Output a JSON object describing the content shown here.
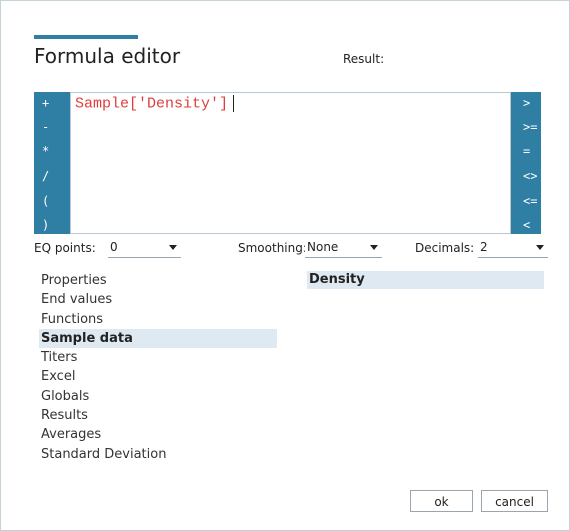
{
  "dialog": {
    "title": "Formula editor",
    "result_label": "Result:"
  },
  "operators": {
    "left": [
      "+",
      "-",
      "*",
      "/",
      "(",
      ")"
    ],
    "right": [
      ">",
      ">=",
      "=",
      "<>",
      "<=",
      "<"
    ]
  },
  "formula": {
    "text": "Sample['Density']"
  },
  "controls": {
    "eq_points": {
      "label": "EQ points:",
      "value": "0"
    },
    "smoothing": {
      "label": "Smoothing:",
      "value": "None"
    },
    "decimals": {
      "label": "Decimals:",
      "value": "2"
    }
  },
  "categories": {
    "items": [
      "Properties",
      "End values",
      "Functions",
      "Sample data",
      "Titers",
      "Excel",
      "Globals",
      "Results",
      "Averages",
      "Standard Deviation"
    ],
    "selected": "Sample data"
  },
  "values": {
    "items": [
      "Density"
    ]
  },
  "buttons": {
    "ok": "ok",
    "cancel": "cancel"
  },
  "colors": {
    "accent": "#2f7ea3",
    "selection": "#dfe9f1",
    "formula_text": "#e03c3c"
  }
}
